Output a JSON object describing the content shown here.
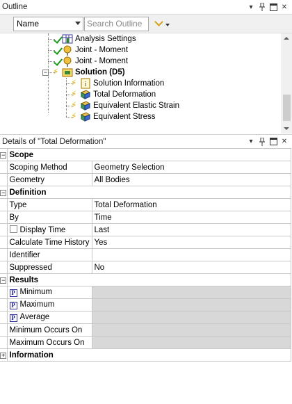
{
  "outline": {
    "title": "Outline",
    "filter_select": "Name",
    "search_placeholder": "Search Outline",
    "tree": [
      {
        "label": "Analysis Settings",
        "icon": "analysis-settings-icon",
        "status": "check"
      },
      {
        "label": "Joint - Moment",
        "icon": "joint-moment-icon",
        "status": "check"
      },
      {
        "label": "Joint - Moment",
        "icon": "joint-moment-icon",
        "status": "check"
      },
      {
        "label": "Solution (D5)",
        "icon": "solution-icon",
        "status": "lightning",
        "bold": true,
        "expanded": true
      },
      {
        "label": "Solution Information",
        "icon": "solution-information-icon",
        "status": "lightning"
      },
      {
        "label": "Total Deformation",
        "icon": "result-icon",
        "status": "lightning"
      },
      {
        "label": "Equivalent Elastic Strain",
        "icon": "result-icon",
        "status": "lightning"
      },
      {
        "label": "Equivalent Stress",
        "icon": "result-icon",
        "status": "lightning"
      }
    ]
  },
  "details": {
    "title": "Details of \"Total Deformation\"",
    "sections": [
      {
        "name": "Scope",
        "expanded": true,
        "rows": [
          {
            "name": "Scoping Method",
            "value": "Geometry Selection"
          },
          {
            "name": "Geometry",
            "value": "All Bodies"
          }
        ]
      },
      {
        "name": "Definition",
        "expanded": true,
        "rows": [
          {
            "name": "Type",
            "value": "Total Deformation"
          },
          {
            "name": "By",
            "value": "Time"
          },
          {
            "name": "Display Time",
            "value": "Last",
            "checkbox": true
          },
          {
            "name": "Calculate Time History",
            "value": "Yes"
          },
          {
            "name": "Identifier",
            "value": ""
          },
          {
            "name": "Suppressed",
            "value": "No"
          }
        ]
      },
      {
        "name": "Results",
        "expanded": true,
        "rows": [
          {
            "name": "Minimum",
            "value": "",
            "param": true
          },
          {
            "name": "Maximum",
            "value": "",
            "param": true
          },
          {
            "name": "Average",
            "value": "",
            "param": true
          },
          {
            "name": "Minimum Occurs On",
            "value": ""
          },
          {
            "name": "Maximum Occurs On",
            "value": ""
          }
        ]
      },
      {
        "name": "Information",
        "expanded": false,
        "rows": []
      }
    ]
  },
  "colors": {
    "check": "#1a9a1a",
    "lightning": "#e0b000",
    "grey_cell": "#d8d8d8",
    "chevron": "#d4a017"
  }
}
